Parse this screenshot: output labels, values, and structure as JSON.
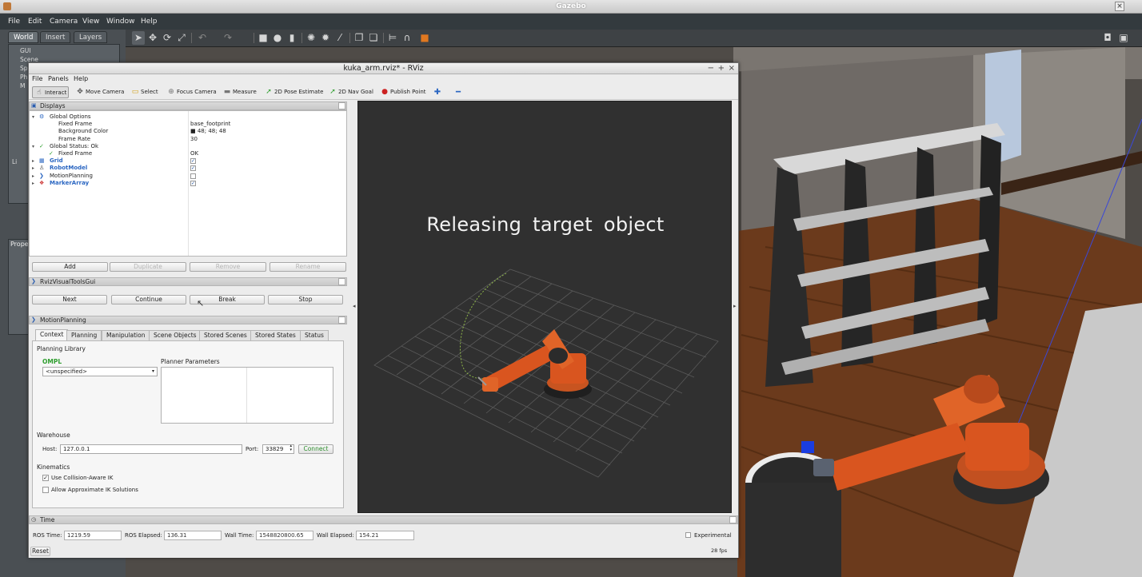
{
  "gazebo": {
    "title": "Gazebo",
    "menu": [
      "File",
      "Edit",
      "Camera",
      "View",
      "Window",
      "Help"
    ],
    "left_tabs": [
      "World",
      "Insert",
      "Layers"
    ],
    "tree_items": [
      "GUI",
      "Scene",
      "Sp",
      "Ph",
      "M",
      "Li"
    ],
    "props_label": "Prope",
    "toolbar_icons": [
      "select-arrow-icon",
      "translate-icon",
      "rotate-icon",
      "scale-icon",
      "undo-icon",
      "redo-icon",
      "box-icon",
      "sphere-icon",
      "cylinder-icon",
      "point-light-icon",
      "spot-light-icon",
      "directional-light-icon",
      "copy-icon",
      "paste-icon",
      "align-icon",
      "snap-icon",
      "record-icon"
    ],
    "right_icons": [
      "screenshot-icon",
      "video-icon"
    ]
  },
  "rviz": {
    "title": "kuka_arm.rviz* - RViz",
    "window_controls": [
      "−",
      "+",
      "×"
    ],
    "menu": [
      "File",
      "Panels",
      "Help"
    ],
    "tools": [
      {
        "label": "Interact",
        "icon": "interact-icon",
        "glyph": "☝",
        "color": "#555555",
        "active": true
      },
      {
        "label": "Move Camera",
        "icon": "move-camera-icon",
        "glyph": "✥",
        "color": "#555555"
      },
      {
        "label": "Select",
        "icon": "select-icon",
        "glyph": "▭",
        "color": "#d4a017"
      },
      {
        "label": "Focus Camera",
        "icon": "focus-camera-icon",
        "glyph": "⊕",
        "color": "#777777"
      },
      {
        "label": "Measure",
        "icon": "measure-icon",
        "glyph": "▬",
        "color": "#777777"
      },
      {
        "label": "2D Pose Estimate",
        "icon": "pose-estimate-icon",
        "glyph": "➚",
        "color": "#2e9e2e"
      },
      {
        "label": "2D Nav Goal",
        "icon": "nav-goal-icon",
        "glyph": "➚",
        "color": "#2e9e2e"
      },
      {
        "label": "Publish Point",
        "icon": "publish-point-icon",
        "glyph": "●",
        "color": "#cc2222"
      }
    ],
    "extra_tools": [
      "plus-icon",
      "minus-icon"
    ],
    "displays": {
      "header": "Displays",
      "rows": [
        {
          "label": "Global Options",
          "value": "",
          "indent": 1,
          "expander": "▾",
          "icon": "⚙",
          "icon_color": "#2a66c2"
        },
        {
          "label": "Fixed Frame",
          "value": "base_footprint",
          "indent": 2
        },
        {
          "label": "Background Color",
          "value": "■ 48; 48; 48",
          "indent": 2
        },
        {
          "label": "Frame Rate",
          "value": "30",
          "indent": 2
        },
        {
          "label": "Global Status: Ok",
          "value": "",
          "indent": 1,
          "expander": "▾",
          "icon": "✓",
          "icon_color": "#2e9e2e"
        },
        {
          "label": "Fixed Frame",
          "value": "OK",
          "indent": 2,
          "icon": "✓",
          "icon_color": "#2e9e2e"
        },
        {
          "label": "Grid",
          "indent": 1,
          "expander": "▸",
          "icon": "▦",
          "icon_color": "#2a66c2",
          "check": "✓",
          "bold": true
        },
        {
          "label": "RobotModel",
          "indent": 1,
          "expander": "▸",
          "icon": "♙",
          "icon_color": "#555555",
          "check": "✓",
          "bold": true
        },
        {
          "label": "MotionPlanning",
          "indent": 1,
          "expander": "▸",
          "icon": "❯",
          "icon_color": "#2a66c2",
          "check": ""
        },
        {
          "label": "MarkerArray",
          "indent": 1,
          "expander": "▸",
          "icon": "❖",
          "icon_color": "#cc3333",
          "check": "✓",
          "bold": true
        }
      ],
      "buttons": [
        "Add",
        "Duplicate",
        "Remove",
        "Rename"
      ]
    },
    "visual_tools": {
      "header": "RvizVisualToolsGui",
      "buttons": [
        "Next",
        "Continue",
        "Break",
        "Stop"
      ]
    },
    "motion_planning": {
      "header": "MotionPlanning",
      "tabs": [
        "Context",
        "Planning",
        "Manipulation",
        "Scene Objects",
        "Stored Scenes",
        "Stored States",
        "Status"
      ],
      "planning_library_label": "Planning Library",
      "library": "OMPL",
      "planner_select": "<unspecified>",
      "planner_parameters_label": "Planner Parameters",
      "warehouse_label": "Warehouse",
      "host_label": "Host:",
      "host": "127.0.0.1",
      "port_label": "Port:",
      "port": "33829",
      "connect_label": "Connect",
      "kinematics_label": "Kinematics",
      "collision_aware_label": "Use Collision-Aware IK",
      "collision_aware_checked": true,
      "approx_ik_label": "Allow Approximate IK Solutions",
      "approx_ik_checked": false
    },
    "view": {
      "overlay_text": "Releasing  target  object",
      "background_color": "#303030"
    },
    "time": {
      "header": "Time",
      "ros_time_label": "ROS Time:",
      "ros_time": "1219.59",
      "ros_elapsed_label": "ROS Elapsed:",
      "ros_elapsed": "136.31",
      "wall_time_label": "Wall Time:",
      "wall_time": "1548820800.65",
      "wall_elapsed_label": "Wall Elapsed:",
      "wall_elapsed": "154.21",
      "experimental_label": "Experimental",
      "fps": "28 fps",
      "reset_label": "Reset"
    }
  },
  "colors": {
    "robot_orange": "#d9551f",
    "gazebo_floor": "#6b3a1c",
    "accent_blue": "#2a66c2"
  }
}
